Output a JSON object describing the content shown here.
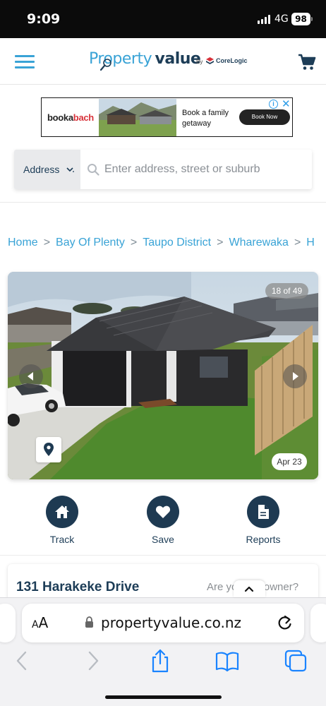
{
  "status_bar": {
    "time": "9:09",
    "network": "4G",
    "battery": "98"
  },
  "header": {
    "logo_primary": "Property",
    "logo_secondary": "value",
    "logo_by": "By",
    "logo_partner": "CoreLogic",
    "accent_color": "#39a3d6",
    "brand_dark": "#1d3d57"
  },
  "ad": {
    "brand_part1": "booka",
    "brand_part2": "bach",
    "headline": "Book a family getaway",
    "cta": "Book Now",
    "info_glyph": "i",
    "close_glyph": "✕"
  },
  "search": {
    "type_label": "Address",
    "placeholder": "Enter address, street or suburb",
    "value": ""
  },
  "breadcrumb": {
    "items": [
      "Home",
      "Bay Of Plenty",
      "Taupo District",
      "Wharewaka",
      "H"
    ],
    "separator": ">"
  },
  "gallery": {
    "counter": "18 of 49",
    "date": "Apr 23",
    "prev_icon": "chevron-left-icon",
    "next_icon": "chevron-right-icon",
    "pin_icon": "map-pin-icon"
  },
  "actions": {
    "track_label": "Track",
    "save_label": "Save",
    "reports_label": "Reports",
    "circle_color": "#1e3a52"
  },
  "property_card": {
    "address": "131 Harakeke Drive",
    "owner_prompt": "Are you the owner?"
  },
  "browser": {
    "aa_large": "A",
    "aa_small": "A",
    "url": "propertyvalue.co.nz"
  }
}
